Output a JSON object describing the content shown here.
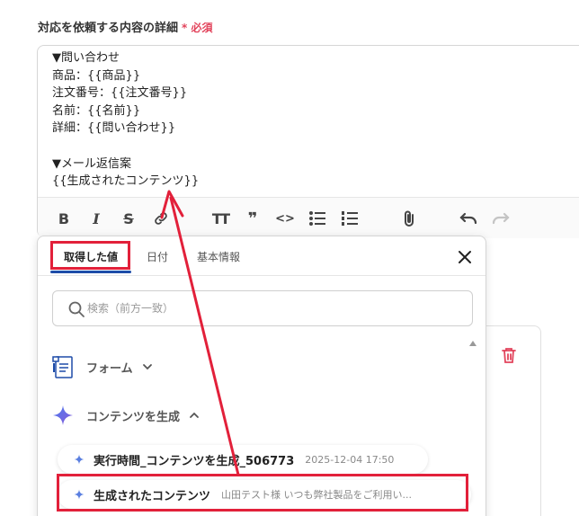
{
  "field": {
    "label": "対応を依頼する内容の詳細",
    "required_mark": "*",
    "required_text": "必須"
  },
  "editor": {
    "lines": [
      "▼問い合わせ",
      "商品：{{商品}}",
      "注文番号：{{注文番号}}",
      "名前：{{名前}}",
      "詳細：{{問い合わせ}}",
      "",
      "▼メール返信案",
      "{{生成されたコンテンツ}}"
    ],
    "toolbar": {
      "bold": "B",
      "italic": "I",
      "strike": "S",
      "heading": "TT",
      "quote": "❞",
      "code": "<>"
    }
  },
  "panel": {
    "tabs": [
      "取得した値",
      "日付",
      "基本情報"
    ],
    "active_tab": "取得した値",
    "search_placeholder": "検索（前方一致）",
    "groups": [
      {
        "label": "フォーム",
        "icon": "form-icon",
        "expanded": false
      },
      {
        "label": "コンテンツを生成",
        "icon": "sparkle-icon",
        "expanded": true
      }
    ],
    "items": [
      {
        "name": "実行時間_コンテンツを生成_506773",
        "value": "2025-12-04 17:50"
      },
      {
        "name": "生成されたコンテンツ",
        "value": "山田テスト様 いつも弊社製品をご利用い..."
      }
    ]
  },
  "colors": {
    "highlight": "#e2203a",
    "accent": "#1e4ca8",
    "required": "#e2445c"
  }
}
